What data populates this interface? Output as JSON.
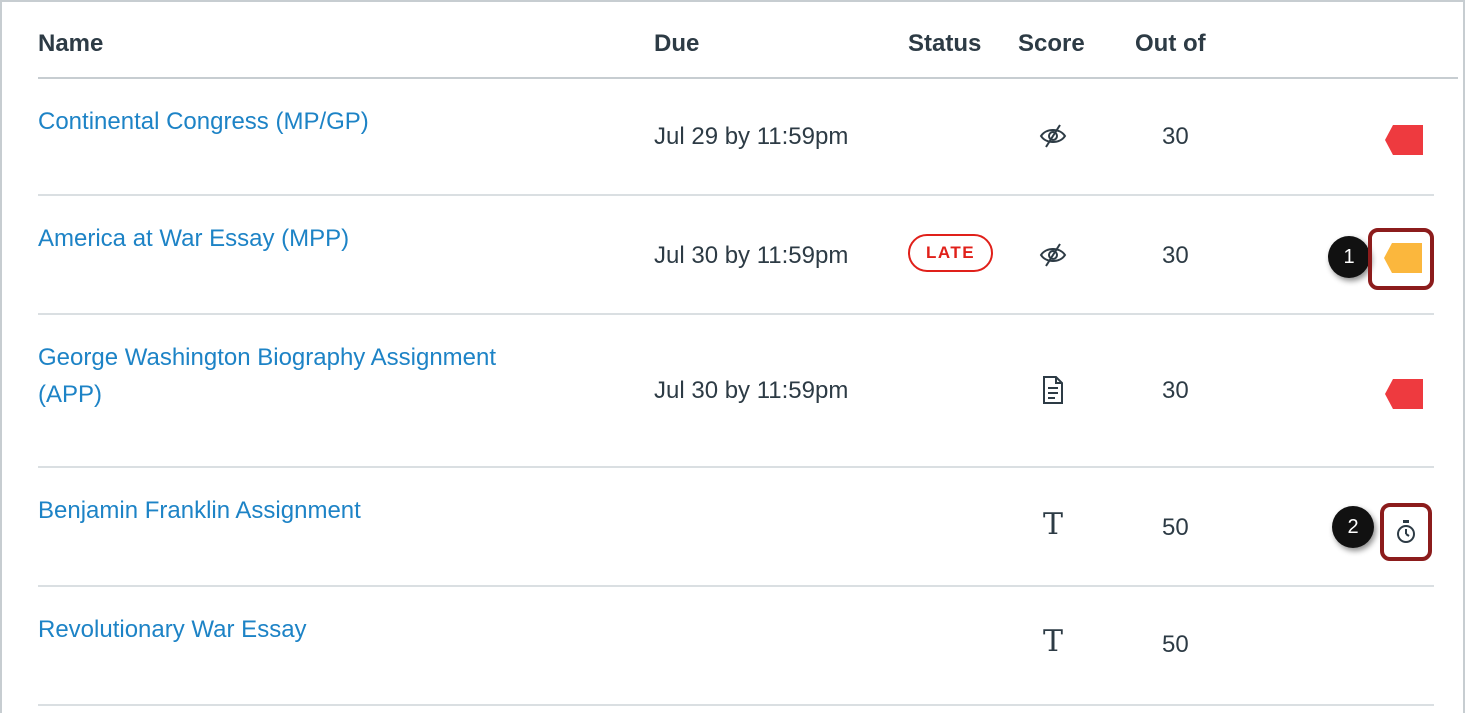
{
  "table": {
    "headers": {
      "name": "Name",
      "due": "Due",
      "status": "Status",
      "score": "Score",
      "out_of": "Out of"
    },
    "rows": [
      {
        "name": "Continental Congress (MP/GP)",
        "due": "Jul 29 by 11:59pm",
        "status": "",
        "score_icon": "eye-slash-icon",
        "out_of": "30",
        "flag_icon": "flag-icon",
        "flag_color": "#ee3a3f"
      },
      {
        "name": "America at War Essay (MPP)",
        "due": "Jul 30 by 11:59pm",
        "status": "LATE",
        "score_icon": "eye-slash-icon",
        "out_of": "30",
        "flag_icon": "flag-icon",
        "flag_color": "#fbb73d",
        "callout": "1"
      },
      {
        "name_line1": "George Washington Biography Assignment",
        "name_line2": "(APP)",
        "due": "Jul 30 by 11:59pm",
        "status": "",
        "score_icon": "document-icon",
        "out_of": "30",
        "flag_icon": "flag-icon",
        "flag_color": "#ee3a3f"
      },
      {
        "name": "Benjamin Franklin Assignment",
        "due": "",
        "status": "",
        "score_icon": "text-entry-icon",
        "score_glyph": "T",
        "out_of": "50",
        "flag_icon": "stopwatch-icon",
        "callout": "2"
      },
      {
        "name": "Revolutionary War Essay",
        "due": "",
        "status": "",
        "score_icon": "text-entry-icon",
        "score_glyph": "T",
        "out_of": "50"
      }
    ]
  },
  "colors": {
    "link": "#1d83c6",
    "late": "#e0201a",
    "highlight": "#8c1c1c"
  }
}
